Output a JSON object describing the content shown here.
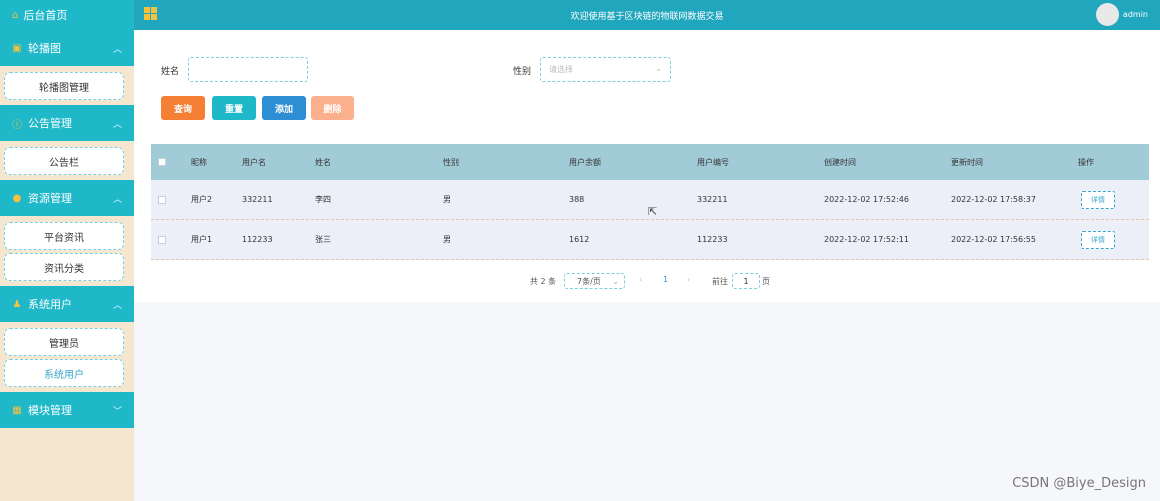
{
  "header": {
    "title": "欢迎使用基于区块链的物联网数据交易",
    "user": "admin"
  },
  "sidebar": {
    "home": "后台首页",
    "groups": [
      {
        "label": "轮播图",
        "items": [
          "轮播图管理"
        ]
      },
      {
        "label": "公告管理",
        "items": [
          "公告栏"
        ]
      },
      {
        "label": "资源管理",
        "items": [
          "平台资讯",
          "资讯分类"
        ]
      },
      {
        "label": "系统用户",
        "items": [
          "管理员",
          "系统用户"
        ]
      },
      {
        "label": "模块管理",
        "items": []
      }
    ]
  },
  "search": {
    "name_label": "姓名",
    "name_value": "",
    "gender_label": "性别",
    "gender_placeholder": "请选择"
  },
  "buttons": {
    "query": "查询",
    "reset": "重置",
    "add": "添加",
    "delete": "删除"
  },
  "colors": {
    "query": "#f57f34",
    "reset": "#1fb8c9",
    "add": "#2d8ed4",
    "delete": "#fbb08d"
  },
  "table": {
    "columns": [
      "昵称",
      "用户名",
      "姓名",
      "性别",
      "用户余额",
      "用户编号",
      "创建时间",
      "更新时间",
      "操作"
    ],
    "rows": [
      {
        "nickname": "用户2",
        "username": "332211",
        "name": "李四",
        "gender": "男",
        "balance": "388",
        "user_no": "332211",
        "created": "2022-12-02 17:52:46",
        "updated": "2022-12-02 17:58:37",
        "action": "详情"
      },
      {
        "nickname": "用户1",
        "username": "112233",
        "name": "张三",
        "gender": "男",
        "balance": "1612",
        "user_no": "112233",
        "created": "2022-12-02 17:52:11",
        "updated": "2022-12-02 17:56:55",
        "action": "详情"
      }
    ]
  },
  "pagination": {
    "total": "共 2 条",
    "page_size": "7条/页",
    "current_page": "1",
    "goto_label": "前往",
    "goto_value": "1",
    "page_unit": "页"
  },
  "watermark": "CSDN @Biye_Design"
}
